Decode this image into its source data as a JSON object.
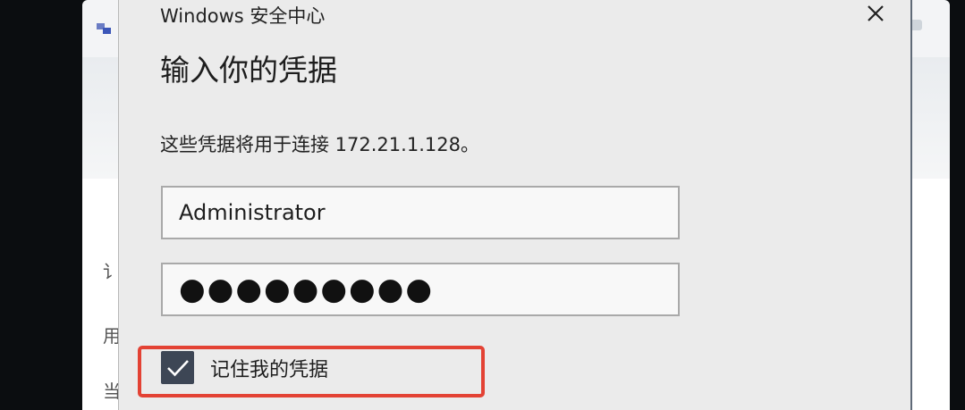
{
  "background_window": {
    "glyphs": [
      "讠",
      "用",
      "当"
    ]
  },
  "dialog": {
    "title": "Windows 安全中心",
    "heading": "输入你的凭据",
    "description": "这些凭据将用于连接 172.21.1.128。",
    "username": {
      "value": "Administrator"
    },
    "password": {
      "masked_value": "●●●●●●●●●"
    },
    "remember": {
      "label": "记住我的凭据",
      "checked": true
    }
  },
  "colors": {
    "dialog_bg": "#ebebeb",
    "checkbox_fill": "#3d4655",
    "highlight_red": "#e34234"
  }
}
